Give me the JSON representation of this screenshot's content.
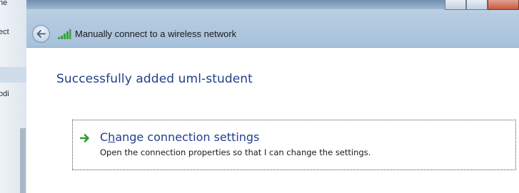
{
  "background_window": {
    "fragment_1": "ne",
    "fragment_2": "ect",
    "fragment_3": "odi"
  },
  "titlebar": {
    "title": "Manually connect to a wireless network",
    "back_icon": "back-arrow-icon",
    "network_icon": "wireless-signal-icon"
  },
  "main": {
    "heading": "Successfully added uml-student",
    "link": {
      "label_prefix": "C",
      "label_access_key": "h",
      "label_suffix": "ange connection settings",
      "description": "Open the connection properties so that I can change the settings.",
      "icon": "green-arrow-icon"
    }
  },
  "colors": {
    "heading": "#1f3f8a",
    "link": "#1e3f8c",
    "arrow": "#2e9a2e"
  }
}
